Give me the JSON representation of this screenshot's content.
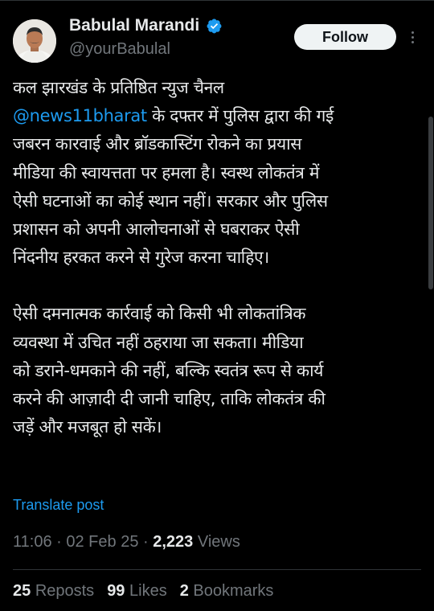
{
  "author": {
    "display_name": "Babulal Marandi",
    "handle": "@yourBabulal",
    "verified_icon": "verified-badge-icon",
    "verified_color": "#1d9bf0"
  },
  "follow_button": {
    "label": "Follow"
  },
  "more_menu": {
    "icon": "more-horizontal-icon"
  },
  "tweet": {
    "para1": {
      "line1": "कल झारखंड के प्रतिष्ठित न्युज चैनल",
      "mention": "@news11bharat",
      "line2_rest": " के दफ्तर में पुलिस द्वारा की गई",
      "line3": "जबरन कारवाई और ब्रॉडकास्टिंग रोकने का प्रयास",
      "line4": "मीडिया की स्वायत्तता पर हमला है। स्वस्थ लोकतंत्र में",
      "line5": "ऐसी घटनाओं का कोई स्थान नहीं। सरकार और पुलिस",
      "line6": "प्रशासन को अपनी आलोचनाओं से घबराकर ऐसी",
      "line7": "निंदनीय हरकत करने से गुरेज करना चाहिए।"
    },
    "para2": {
      "line1": "ऐसी दमनात्मक कार्रवाई को किसी भी लोकतांत्रिक",
      "line2": "व्यवस्था में उचित नहीं ठहराया जा सकता। मीडिया",
      "line3": "को डराने-धमकाने की नहीं, बल्कि स्वतंत्र रूप से कार्य",
      "line4": "करने की आज़ादी दी जानी चाहिए, ताकि लोकतंत्र की",
      "line5": "जड़ें और मजबूत हो सकें।"
    }
  },
  "translate_link": "Translate post",
  "meta": {
    "time": "11:06",
    "separator": "·",
    "date": "02 Feb 25",
    "views_count": "2,223",
    "views_label": "Views"
  },
  "stats": {
    "reposts_count": "25",
    "reposts_label": "Reposts",
    "likes_count": "99",
    "likes_label": "Likes",
    "bookmarks_count": "2",
    "bookmarks_label": "Bookmarks"
  },
  "colors": {
    "background": "#000000",
    "text_primary": "#e7e9ea",
    "text_secondary": "#71767b",
    "accent": "#1d9bf0",
    "follow_bg": "#eff3f4"
  }
}
